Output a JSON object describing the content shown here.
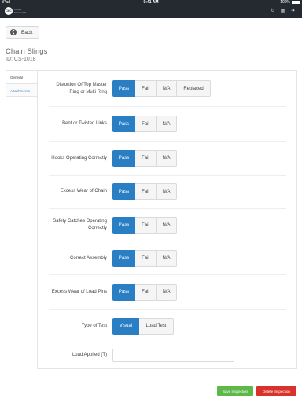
{
  "status": {
    "carrier": "iPad",
    "time": "9:41 AM",
    "battery": "100%"
  },
  "brand": {
    "logo": "CMC",
    "line1": "CHAIN",
    "line2": "MANAGER"
  },
  "back": {
    "label": "Back"
  },
  "page": {
    "title": "Chain Slings",
    "id": "ID: CS-1018"
  },
  "sidebar": {
    "general": "General",
    "attachments": "Attachments"
  },
  "rows": [
    {
      "label": "Distortion Of Top Master Ring or Multi Ring",
      "options": [
        "Pass",
        "Fail",
        "N/A",
        "Replaced"
      ],
      "selected": "Pass"
    },
    {
      "label": "Bent or Twisted Links",
      "options": [
        "Pass",
        "Fail",
        "N/A"
      ],
      "selected": "Pass"
    },
    {
      "label": "Hooks Operating Correctly",
      "options": [
        "Pass",
        "Fail",
        "N/A"
      ],
      "selected": "Pass"
    },
    {
      "label": "Excess Wear of Chain",
      "options": [
        "Pass",
        "Fail",
        "N/A"
      ],
      "selected": "Pass"
    },
    {
      "label": "Safety Catches Operating Correctly",
      "options": [
        "Pass",
        "Fail",
        "N/A"
      ],
      "selected": "Pass"
    },
    {
      "label": "Correct Assembly",
      "options": [
        "Pass",
        "Fail",
        "N/A"
      ],
      "selected": "Pass"
    },
    {
      "label": "Excess Wear of Load Pins",
      "options": [
        "Pass",
        "Fail",
        "N/A"
      ],
      "selected": "Pass"
    },
    {
      "label": "Type of Test",
      "options": [
        "Visual",
        "Load Test"
      ],
      "selected": "Visual"
    }
  ],
  "load": {
    "label": "Load Applied (T)",
    "value": "",
    "placeholder": ""
  },
  "footer": {
    "save": "Save Inspection",
    "delete": "Delete Inspection"
  },
  "colors": {
    "selected": "#2a7ec4",
    "save": "#5cb948",
    "delete": "#d9312b",
    "header": "#252a30"
  }
}
